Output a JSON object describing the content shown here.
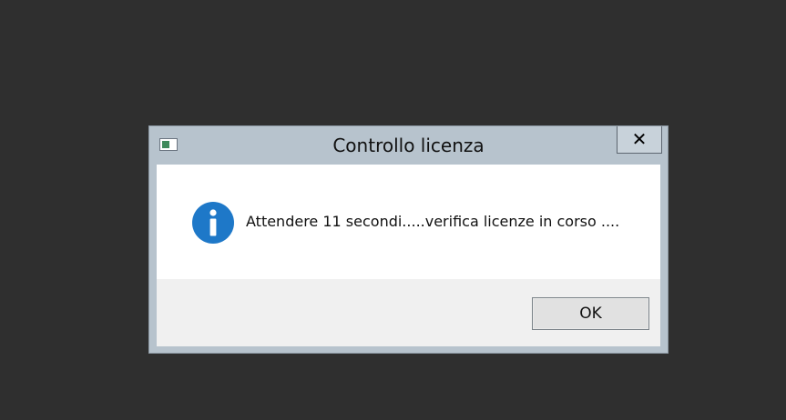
{
  "dialog": {
    "title": "Controllo licenza",
    "close_glyph": "✕",
    "icons": {
      "app": "window-app-icon",
      "message": "info-icon",
      "close": "close-icon"
    },
    "message": "Attendere 11 secondi.....verifica licenze in corso ....",
    "ok_label": "OK"
  },
  "colors": {
    "desktop": "#2f2f2f",
    "frame": "#b7c3cd",
    "info_icon": "#1e78c8",
    "button_area": "#f0f0f0"
  }
}
